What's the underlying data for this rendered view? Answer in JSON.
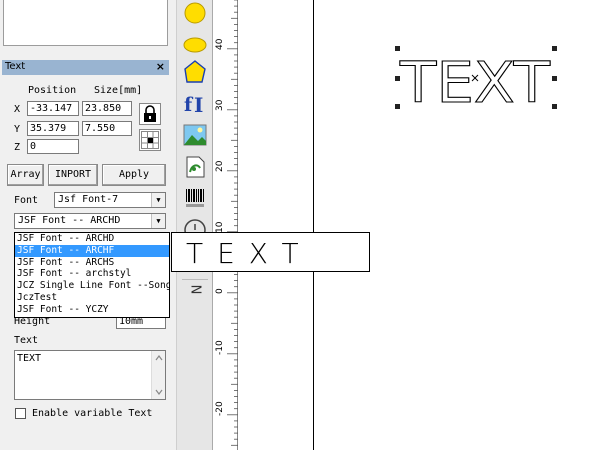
{
  "panel": {
    "title": "Text",
    "close": "×",
    "position_label": "Position",
    "size_label": "Size[mm]",
    "x_label": "X",
    "y_label": "Y",
    "z_label": "Z",
    "x_value": "-33.147",
    "y_value": "35.379",
    "z_value": "0",
    "width_value": "23.850",
    "height_value": "7.550"
  },
  "buttons": {
    "array": "Array",
    "inport": "INPORT",
    "apply": "Apply"
  },
  "font": {
    "label": "Font",
    "type_value": "Jsf Font-7",
    "face_value": "JSF Font -- ARCHD",
    "options": [
      "JSF Font -- ARCHD",
      "JSF Font -- ARCHF",
      "JSF Font -- ARCHS",
      "JSF Font -- archstyl",
      "JCZ Single Line Font --Song",
      "JczTest",
      "JSF Font -- YCZY"
    ],
    "selected_index": 1
  },
  "height": {
    "label": "Height",
    "value": "10mm"
  },
  "text": {
    "label": "Text",
    "value": "TEXT"
  },
  "variable": {
    "label": "Enable variable Text"
  },
  "ruler": {
    "labels": [
      "40",
      "30",
      "20",
      "10",
      "0",
      "-10",
      "-20"
    ]
  },
  "tools": {
    "dimension_label": "N"
  },
  "canvas": {
    "object_text": "TEXT",
    "preview_text": "TEXT"
  },
  "colors": {
    "header": "#99b4d1",
    "selection": "#3399ff",
    "circle_yellow": "#ffdd00"
  }
}
